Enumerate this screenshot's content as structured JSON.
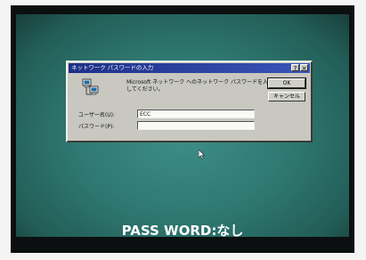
{
  "dialog": {
    "title": "ネットワーク パスワードの入力",
    "help_symbol": "?",
    "close_symbol": "×",
    "message": "Microsoft ネットワーク へのネットワーク パスワードを入力してください。",
    "ok_label": "OK",
    "cancel_label": "キャンセル",
    "username_label": "ユーザー名(U):",
    "username_value": "ECC",
    "password_label": "パスワード(P):",
    "password_value": ""
  },
  "caption": {
    "text": "PASS WORD:なし"
  },
  "colors": {
    "desktop": "#2f7972",
    "titlebar": "#1d2f86",
    "dialog_face": "#c8c8c0"
  },
  "icons": {
    "network": "network-computers-icon",
    "cursor": "mouse-pointer-icon"
  }
}
